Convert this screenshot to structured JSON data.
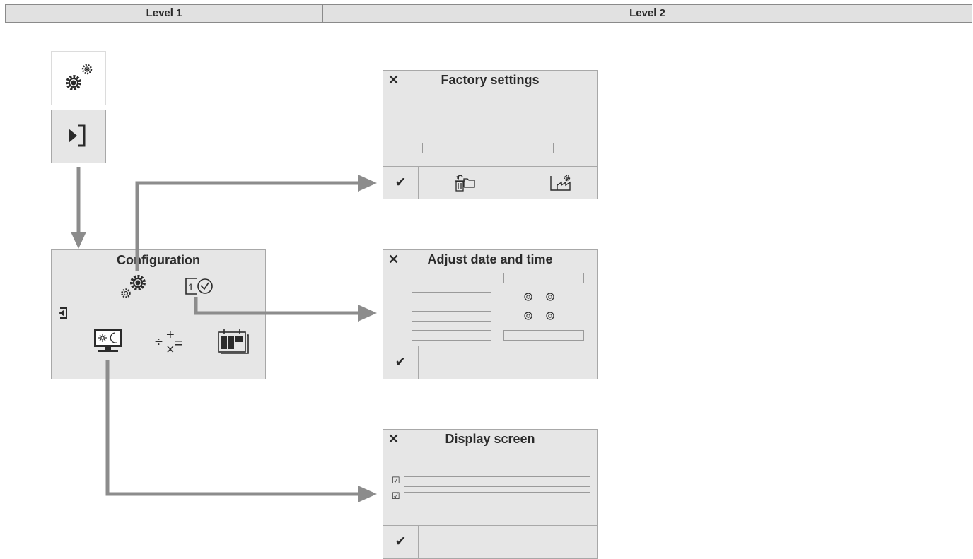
{
  "header": {
    "level1": "Level 1",
    "level2": "Level 2"
  },
  "config": {
    "title": "Configuration"
  },
  "factory": {
    "title": "Factory settings",
    "close": "✕",
    "ok": "✔"
  },
  "datetime": {
    "title": "Adjust date and time",
    "close": "✕",
    "ok": "✔"
  },
  "display": {
    "title": "Display screen",
    "close": "✕",
    "ok": "✔",
    "check1": "☑",
    "check2": "☑"
  },
  "colors": {
    "panel": "#e6e6e6",
    "border": "#a8a8a8",
    "arrow": "#8c8c8c",
    "header": "#e1e1e1"
  },
  "icons": [
    "settings-gears-icon",
    "login-enter-icon",
    "logout-exit-icon",
    "gear-icon",
    "date-time-icon",
    "display-brightness-icon",
    "calculation-icon",
    "calendar-icon",
    "reset-trash-icon",
    "factory-icon"
  ]
}
